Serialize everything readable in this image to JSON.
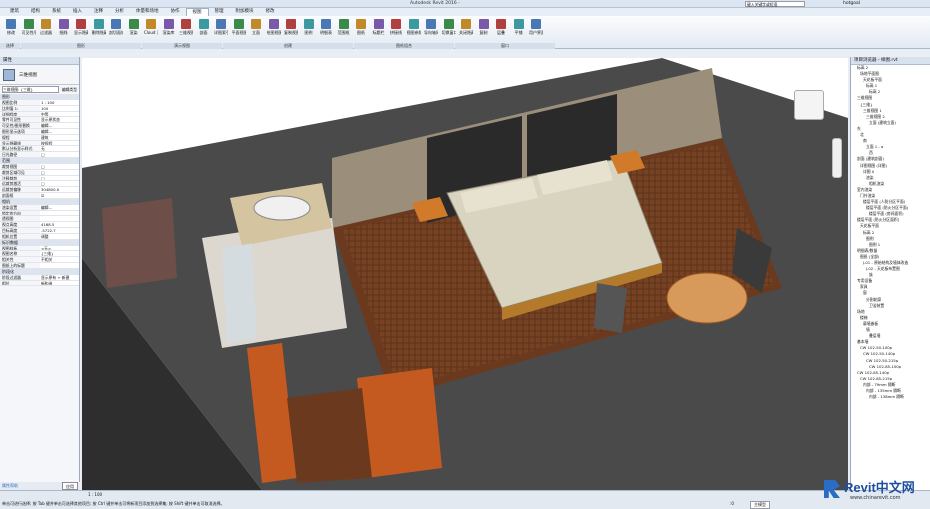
{
  "titlebar": {
    "app_title": "Autodesk Revit 2016 -",
    "search_placeholder": "键入关键字或短语",
    "user": "hotgoal"
  },
  "ribbon_tabs": [
    "建筑",
    "结构",
    "系统",
    "插入",
    "注释",
    "分析",
    "体量和场地",
    "协作",
    "视图",
    "管理",
    "附加模块",
    "修改"
  ],
  "ribbon_active_tab": "视图",
  "ribbon_buttons": [
    "修改",
    "可见性/图形",
    "过滤器",
    "细线",
    "显示隐藏线",
    "删除隐藏线",
    "剖切面轮廓",
    "渲染",
    "Cloud 渲染",
    "渲染库",
    "三维视图",
    "剖面",
    "详图索引",
    "平面视图",
    "立面",
    "绘图视图",
    "复制视图",
    "图例",
    "明细表",
    "范围框",
    "图纸",
    "标题栏",
    "拼接线",
    "视图参照",
    "导向轴网",
    "切换窗口",
    "关闭隐藏",
    "复制",
    "层叠",
    "平铺",
    "用户界面"
  ],
  "ribbon_panels": [
    "选择",
    "图形",
    "演示视图",
    "创建",
    "图纸组合",
    "窗口"
  ],
  "properties": {
    "header": "属性",
    "type_name": "三维视图",
    "selector": "三维视图: {三维}",
    "edit_type": "编辑类型",
    "sections": [
      {
        "title": "图形",
        "rows": [
          [
            "视图比例",
            "1 : 100"
          ],
          [
            "比例值 1:",
            "100"
          ],
          [
            "详细程度",
            "中等"
          ],
          [
            "零件可见性",
            "显示原状态"
          ],
          [
            "可见性/图形替换",
            "编辑..."
          ],
          [
            "图形显示选项",
            "编辑..."
          ],
          [
            "规程",
            "建筑"
          ],
          [
            "显示隐藏线",
            "按规程"
          ],
          [
            "默认分析显示样式",
            "无"
          ],
          [
            "日光路径",
            "□"
          ]
        ]
      },
      {
        "title": "范围",
        "rows": [
          [
            "裁剪视图",
            "□"
          ],
          [
            "裁剪区域可见",
            "□"
          ],
          [
            "注释裁剪",
            "□"
          ],
          [
            "远裁剪激活",
            "□"
          ],
          [
            "远裁剪偏移",
            "304800.0"
          ],
          [
            "剖面框",
            "☑"
          ]
        ]
      },
      {
        "title": "相机",
        "rows": [
          [
            "渲染设置",
            "编辑..."
          ],
          [
            "锁定的方向",
            ""
          ],
          [
            "透视图",
            ""
          ],
          [
            "视点高度",
            "4168.5"
          ],
          [
            "目标高度",
            "-5722.7"
          ],
          [
            "相机位置",
            "调整"
          ]
        ]
      },
      {
        "title": "标识数据",
        "rows": [
          [
            "视图样板",
            "<无>"
          ],
          [
            "视图名称",
            "{三维}"
          ],
          [
            "相关性",
            "不相关"
          ],
          [
            "图纸上的标题",
            ""
          ]
        ]
      },
      {
        "title": "阶段化",
        "rows": [
          [
            "阶段过滤器",
            "显示原有 + 新建"
          ],
          [
            "相位",
            "新构造"
          ]
        ]
      }
    ],
    "help_link": "属性帮助",
    "apply_button": "应用"
  },
  "browser": {
    "header": "项目浏览器 - 样图.rvt",
    "items": [
      "标高 2",
      "场地平面图",
      "天花板平面",
      "标高 1",
      "标高 2",
      "三维视图",
      "{三维}",
      "三维视图 1",
      "三维视图 2",
      "立面 (建筑立面)",
      "东",
      "北",
      "南",
      "立面 1 - a",
      "西",
      "剖面 (建筑剖面)",
      "详图视图 (详图)",
      "详图 0",
      "渲染",
      "相机渲染",
      "室内渲染",
      "门外渲染",
      "楼层平面 (人防分区平面)",
      "楼层平面 (防火分区平面)",
      "楼层平面 (房间面积)",
      "楼层平面 (防火分区面积)",
      "天花板平面",
      "标高 2",
      "图例",
      "图例 1",
      "明细表/数量",
      "图纸 (全部)",
      "J-01 - 原始结构及墙体改造",
      "J-02 - 天花板布置图",
      "族",
      "专用设备",
      "家具",
      "窗",
      "分割轮廓",
      "卫浴装置",
      "场地",
      "楼梯",
      "幕墙嵌板",
      "墙",
      "叠层墙",
      "基本墙",
      "CW 102-50-100p",
      "CW 102-50-140p",
      "CW 102-50-215p",
      "CW 102-85-100p",
      "CW 102-85-140p",
      "CW 102-85-215p",
      "内部 - 79mm 隔断",
      "内部 - 135mm 隔断",
      "内部 - 138mm 隔断"
    ]
  },
  "viewbar": {
    "scale": "1 : 100"
  },
  "status": {
    "message": "单击可进行选择; 按 Tab 键并单击可选择其他项目; 按 Ctrl 键并单击可将新项目添加到选择集; 按 Shift 键并单击可取消选择。",
    "main_model": "主模型",
    "zero": ":0"
  },
  "watermark": {
    "brand": "Revit中文网",
    "url": "www.chinarevit.com"
  },
  "colors": {
    "ribbon_bg": "#e3eaf3",
    "panel_bg": "#f4f6f9",
    "wall_dark": "#3a3a3a",
    "floor_wood": "#6b3a1e",
    "bed": "#d8d4c0",
    "accent_blue": "#2b6cc4"
  }
}
